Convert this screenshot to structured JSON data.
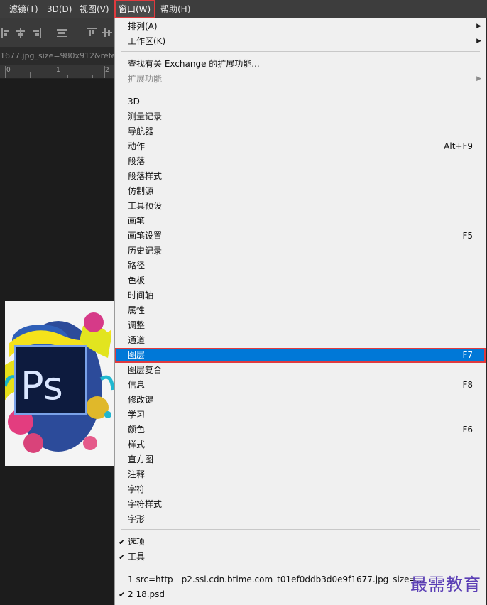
{
  "menubar": {
    "items": [
      {
        "label": "滤镜(T)"
      },
      {
        "label": "3D(D)"
      },
      {
        "label": "视图(V)"
      },
      {
        "label": "窗口(W)"
      },
      {
        "label": "帮助(H)"
      }
    ]
  },
  "document": {
    "tab_title": "1677.jpg_size=980x912&refe",
    "ruler": [
      "0",
      "1",
      "2"
    ]
  },
  "window_menu": {
    "items": [
      {
        "label": "排列(A)",
        "submenu": true
      },
      {
        "label": "工作区(K)",
        "submenu": true
      },
      {
        "label": "查找有关 Exchange 的扩展功能..."
      },
      {
        "label": "扩展功能",
        "submenu": true,
        "disabled": true
      },
      {
        "label": "3D"
      },
      {
        "label": "测量记录"
      },
      {
        "label": "导航器"
      },
      {
        "label": "动作",
        "shortcut": "Alt+F9"
      },
      {
        "label": "段落"
      },
      {
        "label": "段落样式"
      },
      {
        "label": "仿制源"
      },
      {
        "label": "工具预设"
      },
      {
        "label": "画笔"
      },
      {
        "label": "画笔设置",
        "shortcut": "F5"
      },
      {
        "label": "历史记录"
      },
      {
        "label": "路径"
      },
      {
        "label": "色板"
      },
      {
        "label": "时间轴"
      },
      {
        "label": "属性"
      },
      {
        "label": "调整"
      },
      {
        "label": "通道"
      },
      {
        "label": "图层",
        "shortcut": "F7",
        "highlighted": true
      },
      {
        "label": "图层复合"
      },
      {
        "label": "信息",
        "shortcut": "F8"
      },
      {
        "label": "修改键"
      },
      {
        "label": "学习"
      },
      {
        "label": "颜色",
        "shortcut": "F6"
      },
      {
        "label": "样式"
      },
      {
        "label": "直方图"
      },
      {
        "label": "注释"
      },
      {
        "label": "字符"
      },
      {
        "label": "字符样式"
      },
      {
        "label": "字形"
      },
      {
        "label": "选项",
        "checked": true
      },
      {
        "label": "工具",
        "checked": true
      },
      {
        "label": "1 src=http__p2.ssl.cdn.btime.com_t01ef0ddb3d0e9f1677.jpg_size=..."
      },
      {
        "label": "2 18.psd",
        "checked": true
      }
    ],
    "check_glyph": "✔",
    "submenu_glyph": "▶",
    "highlight_color": "#0078d7",
    "annotation_color": "#e03a3e"
  },
  "watermark": "最需教育",
  "artwork": {
    "logo_text": "Ps"
  }
}
